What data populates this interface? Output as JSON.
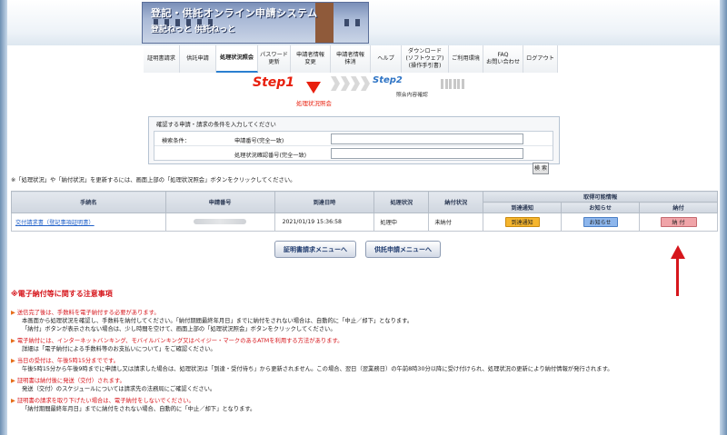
{
  "site": {
    "title": "登記・供託オンライン申請システム",
    "subtitle": "登記ねっと 供託ねっと"
  },
  "nav": [
    {
      "label": "証明書請求"
    },
    {
      "label": "供託申請"
    },
    {
      "label": "処理状況照会"
    },
    {
      "label": "パスワード\n更新"
    },
    {
      "label": "申請者情報\n変更"
    },
    {
      "label": "申請者情報\n抹消"
    },
    {
      "label": "ヘルプ"
    },
    {
      "label": "ダウンロード\n(ソフトウェア)\n(操作手引書)"
    },
    {
      "label": "ご利用環境"
    },
    {
      "label": "FAQ\nお問い合わせ"
    },
    {
      "label": "ログアウト"
    }
  ],
  "steps": {
    "step1": "Step1",
    "step1_label": "処理状況照会",
    "step2": "Step2",
    "step2_label": "照会内容確認"
  },
  "search": {
    "instruction": "確認する申請・請求の条件を入力してください",
    "condition_label": "検索条件：",
    "field1_label": "申請番号(完全一致)",
    "field2_label": "処理状況確認番号(完全一致)",
    "field1_value": "",
    "field2_value": "",
    "button": "検 索"
  },
  "note": "※「処理状況」や「納付状況」を更新するには、画面上部の「処理状況照会」ボタンをクリックしてください。",
  "table": {
    "headers": {
      "procedure": "手続名",
      "app_no": "申請番号",
      "arrival": "到達日時",
      "status": "処理状況",
      "payment": "納付状況",
      "info": "取得可能情報",
      "arrival_notice": "到達通知",
      "notice": "お知らせ",
      "pay": "納付"
    },
    "rows": [
      {
        "procedure": "交付請求書（登記事項証明書）",
        "arrival": "2021/01/19 15:36:58",
        "status": "処理中",
        "payment": "未納付",
        "arrival_btn": "到達通知",
        "notice_btn": "お知らせ",
        "pay_btn": "納 付"
      }
    ]
  },
  "menu": {
    "cert": "証明書請求メニューへ",
    "deposit": "供託申請メニューへ"
  },
  "notes": {
    "title": "※電子納付等に関する注意事項",
    "items": [
      {
        "head": "送信完了後は、手数料を電子納付する必要があります。",
        "lines": [
          "本画面から処理状況を確認し、手数料を納付してください。「納付期間最終年月日」までに納付をされない場合は、自動的に「中止／却下」となります。",
          "「納付」ボタンが表示されない場合は、少し時間を空けて、画面上部の「処理状況照会」ボタンをクリックしてください。"
        ]
      },
      {
        "head": "電子納付には、インターネットバンキング、モバイルバンキング又はペイジー・マークのあるATMを利用する方法があります。",
        "lines": [
          "詳細は「電子納付による手数料等のお支払いについて」をご確認ください。"
        ]
      },
      {
        "head": "当日の受付は、午後5時15分までです。",
        "lines": [
          "午後5時15分から午後9時までに申請し又は請求した場合は、処理状況は「到達・受付待ち」から更新されません。この場合、翌日（翌業務日）の午前8時30分以降に受け付けられ、処理状況の更新により納付情報が発行されます。"
        ]
      },
      {
        "head": "証明書は納付後に発送（交付）されます。",
        "lines": [
          "発送（交付）のスケジュールについては請求先の法務局にご確認ください。"
        ]
      },
      {
        "head": "証明書の請求を取り下げたい場合は、電子納付をしないでください。",
        "lines": [
          "「納付期間最終年月日」までに納付をされない場合、自動的に「中止／却下」となります。"
        ]
      }
    ]
  }
}
